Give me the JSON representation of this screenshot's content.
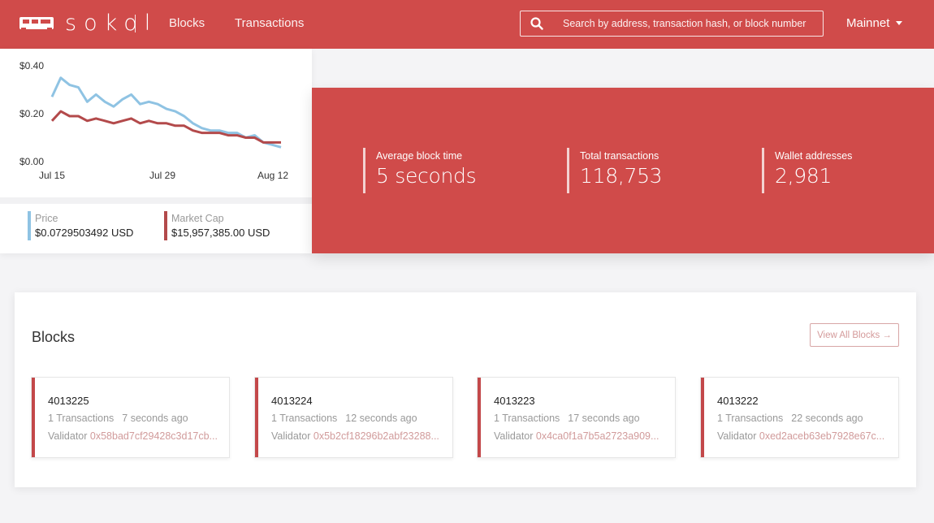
{
  "header": {
    "logo_text": "sokol",
    "nav": [
      {
        "label": "Blocks"
      },
      {
        "label": "Transactions"
      }
    ],
    "search_placeholder": "Search by address, transaction hash, or block number",
    "network": "Mainnet"
  },
  "chart_data": {
    "type": "line",
    "x_ticks": [
      "Jul 15",
      "Jul 29",
      "Aug 12"
    ],
    "y_ticks": [
      "$0.40",
      "$0.20",
      "$0.00"
    ],
    "ylim": [
      0,
      0.4
    ],
    "series": [
      {
        "name": "Price",
        "color": "#8fc3e3",
        "values": [
          0.27,
          0.35,
          0.32,
          0.31,
          0.25,
          0.28,
          0.25,
          0.23,
          0.26,
          0.28,
          0.24,
          0.25,
          0.24,
          0.22,
          0.21,
          0.19,
          0.16,
          0.14,
          0.13,
          0.13,
          0.12,
          0.12,
          0.1,
          0.11,
          0.08,
          0.07,
          0.06
        ]
      },
      {
        "name": "Market Cap",
        "color": "#b34a4b",
        "values": [
          0.17,
          0.21,
          0.19,
          0.19,
          0.17,
          0.18,
          0.17,
          0.16,
          0.17,
          0.18,
          0.16,
          0.17,
          0.16,
          0.16,
          0.15,
          0.15,
          0.13,
          0.12,
          0.12,
          0.12,
          0.11,
          0.11,
          0.1,
          0.1,
          0.08,
          0.08,
          0.08
        ]
      }
    ]
  },
  "market": {
    "price_label": "Price",
    "price_value": "$0.0729503492 USD",
    "price_color": "#8fc3e3",
    "cap_label": "Market Cap",
    "cap_value": "$15,957,385.00 USD",
    "cap_color": "#b34a4b"
  },
  "stats": [
    {
      "label": "Average block time",
      "value": "5 seconds"
    },
    {
      "label": "Total transactions",
      "value": "118,753"
    },
    {
      "label": "Wallet addresses",
      "value": "2,981"
    }
  ],
  "blocks": {
    "title": "Blocks",
    "view_all": "View All Blocks →",
    "validator_label": "Validator",
    "items": [
      {
        "number": "4013225",
        "tx": "1 Transactions",
        "age": "7 seconds ago",
        "validator": "0x58bad7cf29428c3d17cb..."
      },
      {
        "number": "4013224",
        "tx": "1 Transactions",
        "age": "12 seconds ago",
        "validator": "0x5b2cf18296b2abf23288..."
      },
      {
        "number": "4013223",
        "tx": "1 Transactions",
        "age": "17 seconds ago",
        "validator": "0x4ca0f1a7b5a2723a909..."
      },
      {
        "number": "4013222",
        "tx": "1 Transactions",
        "age": "22 seconds ago",
        "validator": "0xed2aceb63eb7928e67c..."
      }
    ]
  },
  "colors": {
    "brand": "#d04b4a",
    "accent": "#c3484a"
  }
}
